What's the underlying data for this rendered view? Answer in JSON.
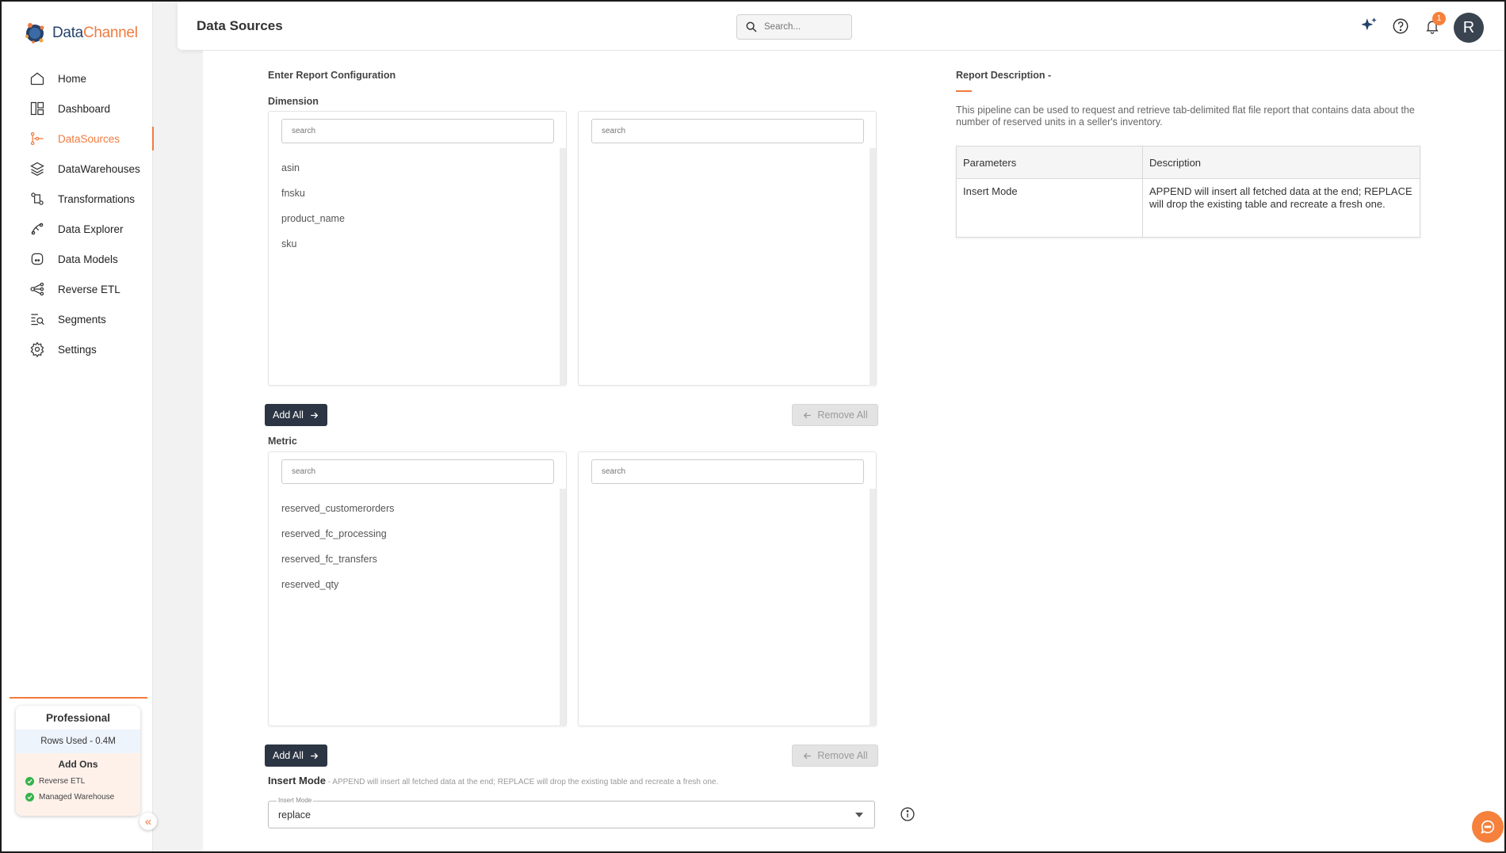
{
  "app": {
    "logo_part1": "Data",
    "logo_part2": "Channel",
    "brand_color": "#25426b",
    "accent_color": "#f07b3f"
  },
  "sidebar": {
    "items": [
      {
        "label": "Home",
        "icon": "home-icon",
        "active": false
      },
      {
        "label": "Dashboard",
        "icon": "dashboard-icon",
        "active": false
      },
      {
        "label": "DataSources",
        "icon": "datasources-icon",
        "active": true
      },
      {
        "label": "DataWarehouses",
        "icon": "layers-icon",
        "active": false
      },
      {
        "label": "Transformations",
        "icon": "transform-icon",
        "active": false
      },
      {
        "label": "Data Explorer",
        "icon": "explorer-icon",
        "active": false
      },
      {
        "label": "Data Models",
        "icon": "models-icon",
        "active": false
      },
      {
        "label": "Reverse ETL",
        "icon": "reverse-etl-icon",
        "active": false
      },
      {
        "label": "Segments",
        "icon": "segments-icon",
        "active": false
      },
      {
        "label": "Settings",
        "icon": "gear-icon",
        "active": false
      }
    ],
    "plan": {
      "title": "Professional",
      "rows_used": "Rows Used - 0.4M",
      "addons_title": "Add Ons",
      "addons": [
        "Reverse ETL",
        "Managed Warehouse"
      ]
    },
    "collapse_glyph": "«"
  },
  "header": {
    "title": "Data Sources",
    "search_placeholder": "Search...",
    "notification_count": "1",
    "avatar_letter": "R"
  },
  "config": {
    "section_title": "Enter Report Configuration",
    "dimension": {
      "label": "Dimension",
      "left_search_placeholder": "search",
      "right_search_placeholder": "search",
      "available": [
        "asin",
        "fnsku",
        "product_name",
        "sku"
      ],
      "selected": []
    },
    "metric": {
      "label": "Metric",
      "left_search_placeholder": "search",
      "right_search_placeholder": "search",
      "available": [
        "reserved_customerorders",
        "reserved_fc_processing",
        "reserved_fc_transfers",
        "reserved_qty"
      ],
      "selected": []
    },
    "add_all_label": "Add All",
    "remove_all_label": "Remove All",
    "insert_mode": {
      "label": "Insert Mode",
      "hint": " - APPEND will insert all fetched data at the end; REPLACE will drop the existing table and recreate a fresh one.",
      "floating_label": "Insert Mode",
      "value": "replace"
    }
  },
  "report": {
    "title": "Report Description -",
    "description": "This pipeline can be used to request and retrieve tab-delimited flat file report that contains data about the number of reserved units in a seller's inventory.",
    "table": {
      "headers": [
        "Parameters",
        "Description"
      ],
      "rows": [
        [
          "Insert Mode",
          "APPEND will insert all fetched data at the end; REPLACE will drop the existing table and recreate a fresh one."
        ]
      ]
    }
  }
}
